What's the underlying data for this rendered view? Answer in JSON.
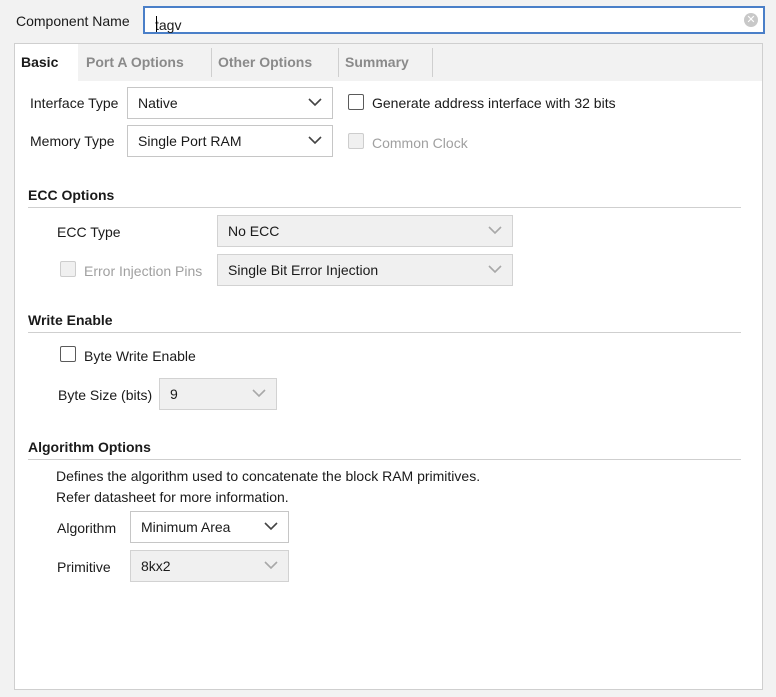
{
  "component": {
    "label": "Component Name",
    "value": "tagv"
  },
  "tabs": [
    {
      "label": "Basic",
      "active": true
    },
    {
      "label": "Port A Options",
      "active": false
    },
    {
      "label": "Other Options",
      "active": false
    },
    {
      "label": "Summary",
      "active": false
    }
  ],
  "basic": {
    "interface_type_label": "Interface Type",
    "interface_type_value": "Native",
    "memory_type_label": "Memory Type",
    "memory_type_value": "Single Port RAM",
    "gen_addr_label": "Generate address interface with 32 bits",
    "gen_addr_checked": false,
    "common_clock_label": "Common Clock",
    "common_clock_checked": false
  },
  "ecc": {
    "title": "ECC Options",
    "type_label": "ECC Type",
    "type_value": "No ECC",
    "error_injection_label": "Error Injection Pins",
    "error_injection_value": "Single Bit Error Injection"
  },
  "write_enable": {
    "title": "Write Enable",
    "byte_write_label": "Byte Write Enable",
    "byte_size_label": "Byte Size (bits)",
    "byte_size_value": "9"
  },
  "algorithm": {
    "title": "Algorithm Options",
    "desc_line1": "Defines the algorithm used to concatenate the block RAM primitives.",
    "desc_line2": "Refer datasheet for more information.",
    "algorithm_label": "Algorithm",
    "algorithm_value": "Minimum Area",
    "primitive_label": "Primitive",
    "primitive_value": "8kx2"
  },
  "colors": {
    "focus_border": "#4a7fc8",
    "disabled_text": "#a0a0a0"
  }
}
